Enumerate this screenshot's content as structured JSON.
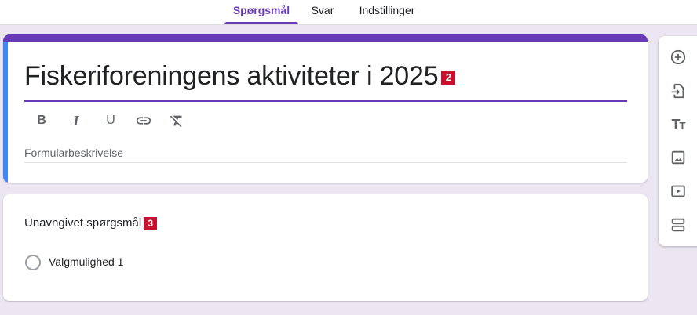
{
  "tabs": [
    {
      "label": "Spørgsmål",
      "active": true
    },
    {
      "label": "Svar",
      "active": false
    },
    {
      "label": "Indstillinger",
      "active": false
    }
  ],
  "form": {
    "title": "Fiskeriforeningens aktiviteter i 2025",
    "title_badge": "2",
    "description_placeholder": "Formularbeskrivelse",
    "formatting": [
      {
        "icon": "bold-icon",
        "glyph": "B"
      },
      {
        "icon": "italic-icon",
        "glyph": "I"
      },
      {
        "icon": "underline-icon",
        "glyph": "U"
      },
      {
        "icon": "link-icon",
        "glyph": "link"
      },
      {
        "icon": "clear-formatting-icon",
        "glyph": "Tx"
      }
    ]
  },
  "question": {
    "title": "Unavngivet spørgsmål",
    "badge": "3",
    "option_label": "Valgmulighed 1"
  },
  "sidebar": [
    {
      "icon": "add-question-icon"
    },
    {
      "icon": "import-questions-icon"
    },
    {
      "icon": "add-title-icon"
    },
    {
      "icon": "add-image-icon"
    },
    {
      "icon": "add-video-icon"
    },
    {
      "icon": "add-section-icon"
    }
  ],
  "colors": {
    "accent": "#673ab7",
    "focus": "#4285f4",
    "background": "#ece6f2",
    "badge": "#c8102e"
  }
}
